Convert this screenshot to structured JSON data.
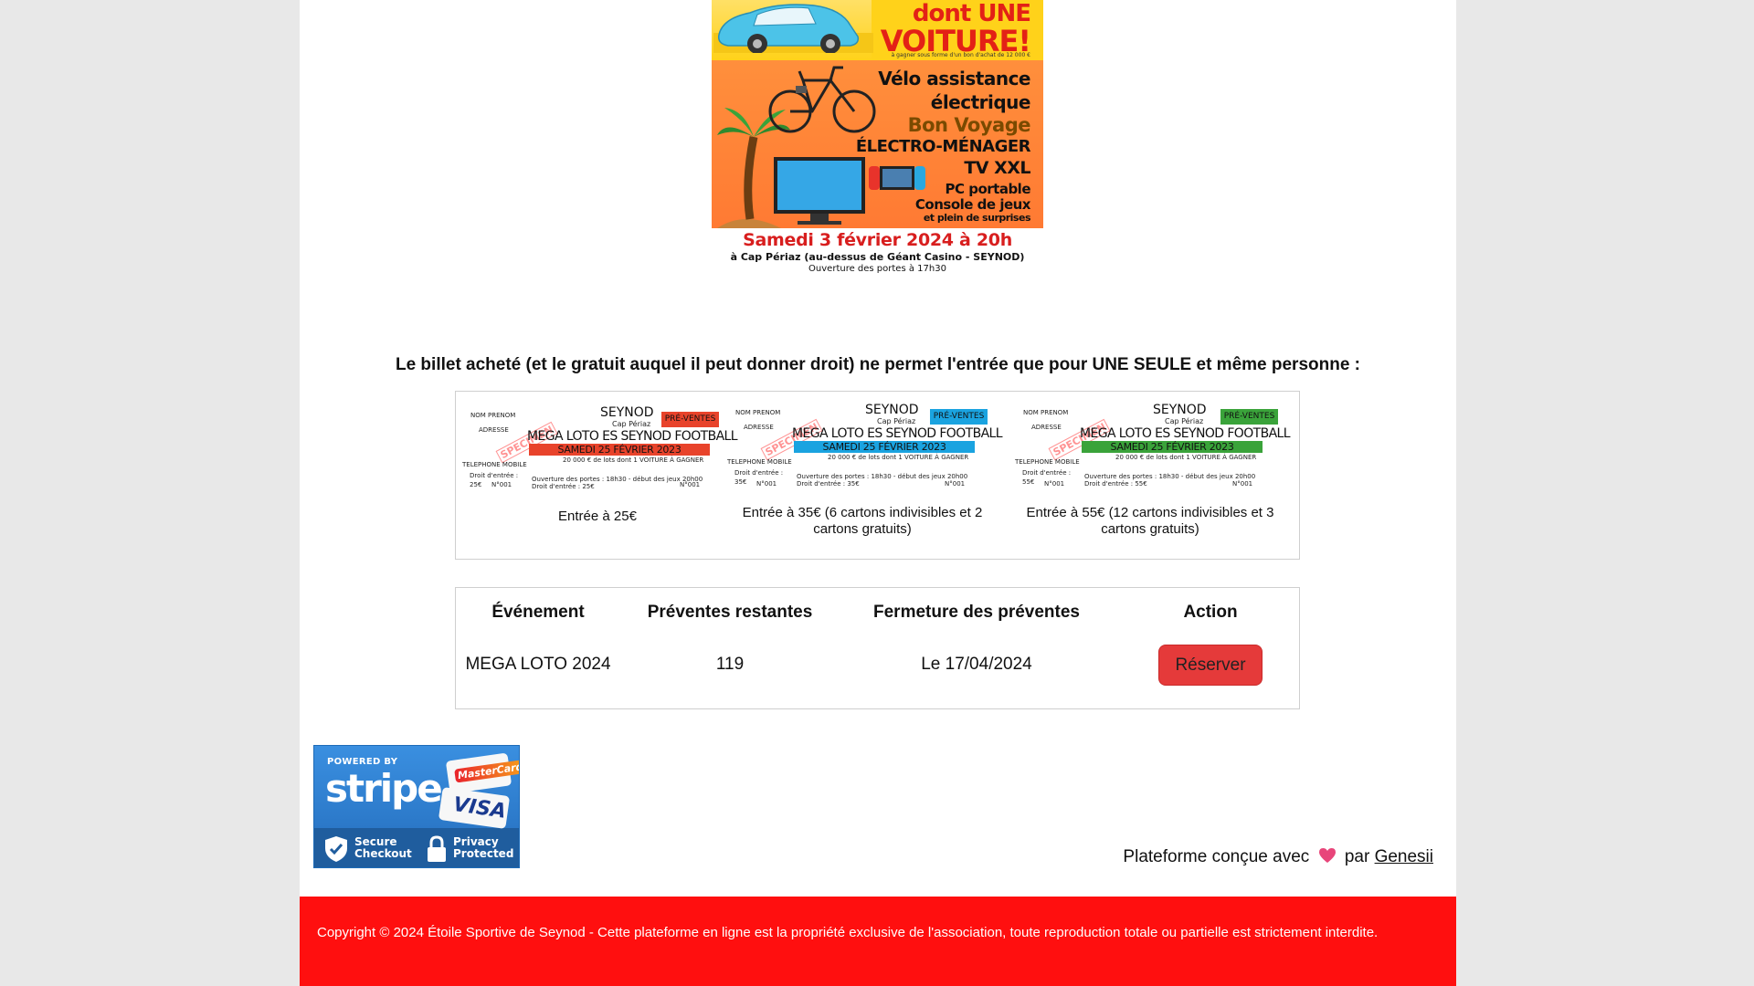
{
  "poster": {
    "headline_dont": "dont UNE",
    "headline_voiture": "VOITURE!",
    "headline_note": "à gagner sous forme d'un bon d'achat de 12 000 €",
    "prizes": [
      "Vélo assistance",
      "électrique",
      "Bon Voyage",
      "ÉLECTRO-MÉNAGER",
      "TV XXL",
      "PC portable",
      "Console de jeux",
      "et plein de surprises"
    ],
    "date": "Samedi 3 février 2024 à 20h",
    "place": "à Cap Périaz (au-dessus de Géant Casino - SEYNOD)",
    "doors": "Ouverture des portes à 17h30"
  },
  "notice": "Le billet acheté (et le gratuit auquel il peut donner droit) ne permet l'entrée que pour UNE SEULE et même personne :",
  "ticket_common": {
    "nom": "NOM PRENOM",
    "adresse": "ADRESSE",
    "specimen": "SPECIMEN",
    "city": "SEYNOD",
    "cap": "Cap Périaz",
    "title": "MEGA LOTO ES SEYNOD FOOTBALL",
    "date": "SAMEDI 25 FÉVRIER 2023",
    "lots": "20 000 € de lots dont 1 VOITURE À GAGNER",
    "tel": "TELEPHONE MOBILE",
    "droit": "Droit d'entrée :",
    "doors": "Ouverture des portes : 18h30 - début des jeux 20h00",
    "num": "N°001",
    "pre": "PRÉ-VENTES"
  },
  "tickets": [
    {
      "caption": "Entrée à 25€",
      "price": "25€",
      "droit_line": "Droit d'entrée : 25€",
      "color": "#e8432b"
    },
    {
      "caption": "Entrée à 35€ (6 cartons indivisibles et 2 cartons gratuits)",
      "price": "35€",
      "droit_line": "Droit d'entrée : 35€",
      "color": "#1aa3e0"
    },
    {
      "caption": "Entrée à 55€ (12 cartons indivisibles et 3 cartons gratuits)",
      "price": "55€",
      "droit_line": "Droit d'entrée : 55€",
      "color": "#3aa33a"
    }
  ],
  "events": {
    "headers": [
      "Événement",
      "Préventes restantes",
      "Fermeture des préventes",
      "Action"
    ],
    "rows": [
      {
        "event": "MEGA LOTO 2024",
        "remaining": "119",
        "closing": "Le 17/04/2024",
        "action": "Réserver"
      }
    ]
  },
  "stripe": {
    "powered": "POWERED BY",
    "word": "stripe",
    "mastercard": "MasterCard",
    "visa": "VISA",
    "secure": [
      "Secure",
      "Checkout"
    ],
    "privacy": [
      "Privacy",
      "Protected"
    ]
  },
  "madewith": {
    "prefix": "Plateforme conçue avec",
    "by": "par",
    "link": "Genesii",
    "heart_color": "#e8457a"
  },
  "footer": {
    "text": "Copyright © 2024 Étoile Sportive de Seynod - Cette plateforme en ligne est la propriété exclusive de l'association, toute reproduction totale ou partielle est strictement interdite."
  },
  "colors": {
    "footer_bg": "#ff0f0f",
    "reserve_bg": "#e53a3a",
    "page_bg": "#e8e8e8"
  }
}
